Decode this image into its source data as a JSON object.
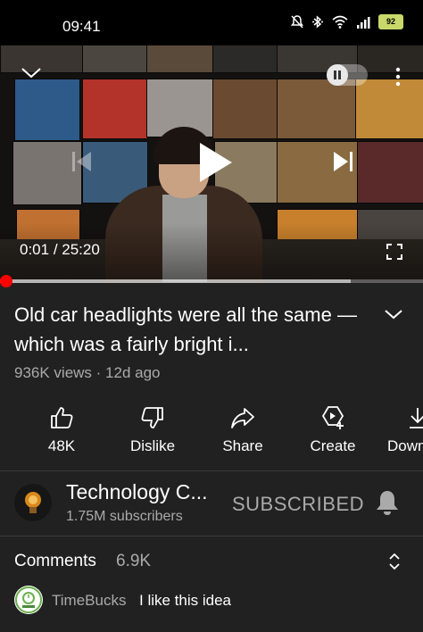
{
  "status_bar": {
    "time": "09:41",
    "battery": "92"
  },
  "player": {
    "current_time": "0:01",
    "separator": " / ",
    "duration": "25:20",
    "progress_fraction": 0.0007,
    "buffered_fraction": 0.83,
    "accent_color": "#ff0000"
  },
  "video": {
    "title": "Old car headlights were all the same — which was a fairly bright i...",
    "views": "936K views",
    "dot": " · ",
    "age": "12d ago"
  },
  "actions": [
    {
      "label": "48K",
      "icon": "thumbs-up-icon"
    },
    {
      "label": "Dislike",
      "icon": "thumbs-down-icon"
    },
    {
      "label": "Share",
      "icon": "share-icon"
    },
    {
      "label": "Create",
      "icon": "create-icon"
    },
    {
      "label": "Down",
      "icon": "download-icon"
    }
  ],
  "channel": {
    "name": "Technology C...",
    "subscribers": "1.75M subscribers",
    "subscribe_label": "SUBSCRIBED"
  },
  "comments": {
    "label": "Comments",
    "count": "6.9K",
    "preview_author": "TimeBucks",
    "preview_text": "I like this idea"
  }
}
